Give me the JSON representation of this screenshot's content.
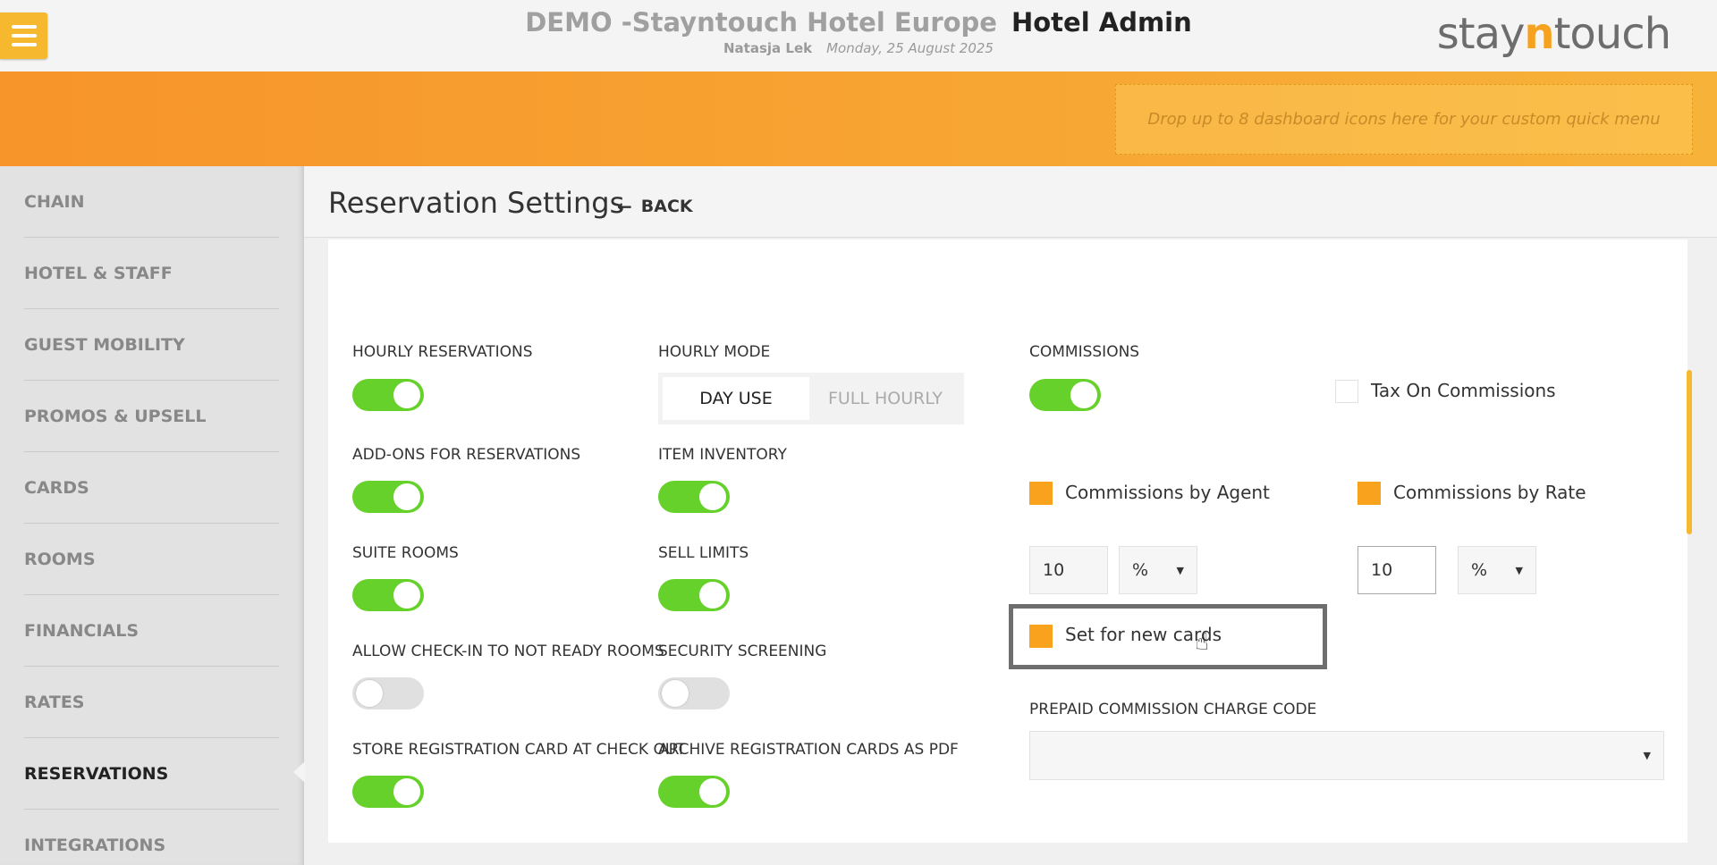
{
  "header": {
    "property_name": "DEMO -Stayntouch Hotel Europe",
    "app_name": "Hotel Admin",
    "user": "Natasja Lek",
    "date": "Monday, 25 August 2025",
    "logo_left": "stay",
    "logo_n": "n",
    "logo_right": "touch"
  },
  "quick_menu": {
    "dropzone_text": "Drop up to 8 dashboard icons here for your custom quick menu"
  },
  "sidebar": {
    "items": [
      {
        "label": "CHAIN"
      },
      {
        "label": "HOTEL & STAFF"
      },
      {
        "label": "GUEST MOBILITY"
      },
      {
        "label": "PROMOS & UPSELL"
      },
      {
        "label": "CARDS"
      },
      {
        "label": "ROOMS"
      },
      {
        "label": "FINANCIALS"
      },
      {
        "label": "RATES"
      },
      {
        "label": "RESERVATIONS"
      },
      {
        "label": "INTEGRATIONS"
      }
    ],
    "active": "RESERVATIONS"
  },
  "page": {
    "title": "Reservation Settings",
    "back_label": "BACK"
  },
  "settings": {
    "hourly_reservations": {
      "label": "HOURLY RESERVATIONS",
      "on": true
    },
    "hourly_mode": {
      "label": "HOURLY MODE",
      "options": [
        "DAY USE",
        "FULL HOURLY"
      ],
      "selected": "DAY USE"
    },
    "addons": {
      "label": "ADD-ONS FOR RESERVATIONS",
      "on": true
    },
    "item_inventory": {
      "label": "ITEM INVENTORY",
      "on": true
    },
    "suite_rooms": {
      "label": "SUITE ROOMS",
      "on": true
    },
    "sell_limits": {
      "label": "SELL LIMITS",
      "on": true
    },
    "allow_checkin": {
      "label": "ALLOW CHECK-IN TO NOT READY ROOMS",
      "on": false
    },
    "security_screening": {
      "label": "SECURITY SCREENING",
      "on": false
    },
    "store_reg_card": {
      "label": "STORE REGISTRATION CARD AT CHECK OUT",
      "on": true
    },
    "archive_reg_cards": {
      "label": "ARCHIVE REGISTRATION CARDS AS PDF",
      "on": true
    }
  },
  "commissions": {
    "label": "COMMISSIONS",
    "on": true,
    "tax_on_commissions": {
      "label": "Tax On Commissions",
      "checked": false
    },
    "by_agent": {
      "label": "Commissions by Agent",
      "checked": true,
      "value": "10",
      "unit": "%"
    },
    "by_rate": {
      "label": "Commissions by Rate",
      "checked": true,
      "value": "10",
      "unit": "%"
    },
    "set_for_new_cards": {
      "label": "Set for new cards",
      "checked": true
    },
    "prepaid_charge_code": {
      "label": "PREPAID COMMISSION CHARGE CODE",
      "value": ""
    }
  },
  "colors": {
    "accent_orange": "#f8a21d",
    "toggle_on": "#66d12b",
    "toggle_off": "#e0e0e0"
  }
}
